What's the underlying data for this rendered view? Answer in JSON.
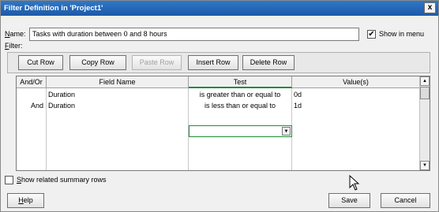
{
  "window": {
    "title": "Filter Definition in 'Project1'",
    "close_label": "x"
  },
  "name_field": {
    "label": "Name:",
    "value": "Tasks with duration between 0 and 8 hours"
  },
  "show_in_menu": {
    "label": "Show in menu",
    "checked": true,
    "check_glyph": "✔"
  },
  "filter_label": "Filter:",
  "toolbar": {
    "cut_row": "Cut Row",
    "copy_row": "Copy Row",
    "paste_row": "Paste Row",
    "insert_row": "Insert Row",
    "delete_row": "Delete Row"
  },
  "grid": {
    "columns": [
      "And/Or",
      "Field Name",
      "Test",
      "Value(s)"
    ],
    "rows": [
      {
        "andor": "",
        "field": "Duration",
        "test": "is greater than or equal to",
        "value": "0d"
      },
      {
        "andor": "And",
        "field": "Duration",
        "test": "is less than or equal to",
        "value": "1d"
      }
    ]
  },
  "show_summary": {
    "label": "Show related summary rows",
    "checked": false
  },
  "footer": {
    "help": "Help",
    "save": "Save",
    "cancel": "Cancel"
  },
  "icons": {
    "scroll_up": "▲",
    "scroll_down": "▼",
    "dropdown": "▼"
  }
}
